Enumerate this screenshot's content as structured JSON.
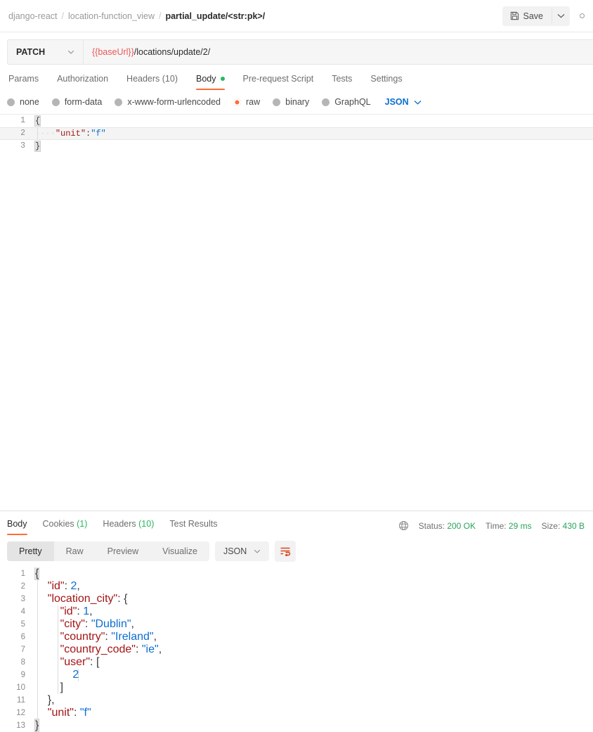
{
  "header": {
    "breadcrumb": [
      "django-react",
      "location-function_view",
      "partial_update/<str:pk>/"
    ],
    "separator": "/",
    "save_label": "Save",
    "save_icon": "floppy-disk-icon",
    "caret_icon": "chevron-down-icon",
    "more_icon": "more-options-icon"
  },
  "request": {
    "method": "PATCH",
    "url_variable": "{{baseUrl}}",
    "url_path": "/locations/update/2/",
    "tabs": [
      {
        "label": "Params",
        "active": false,
        "dot": false
      },
      {
        "label": "Authorization",
        "active": false,
        "dot": false
      },
      {
        "label": "Headers (10)",
        "active": false,
        "dot": false
      },
      {
        "label": "Body",
        "active": true,
        "dot": true
      },
      {
        "label": "Pre-request Script",
        "active": false,
        "dot": false
      },
      {
        "label": "Tests",
        "active": false,
        "dot": false
      },
      {
        "label": "Settings",
        "active": false,
        "dot": false
      }
    ],
    "body_types": [
      {
        "label": "none",
        "selected": false
      },
      {
        "label": "form-data",
        "selected": false
      },
      {
        "label": "x-www-form-urlencoded",
        "selected": false
      },
      {
        "label": "raw",
        "selected": true
      },
      {
        "label": "binary",
        "selected": false
      },
      {
        "label": "GraphQL",
        "selected": false
      }
    ],
    "format": "JSON",
    "body_lines": [
      {
        "num": "1",
        "active": false,
        "tokens": [
          {
            "t": "{",
            "c": "brace-hl p"
          }
        ]
      },
      {
        "num": "2",
        "active": true,
        "tokens": [
          {
            "t": "····",
            "c": "ws"
          },
          {
            "t": "\"unit\"",
            "c": "k"
          },
          {
            "t": ":",
            "c": "p"
          },
          {
            "t": "\"f\"",
            "c": "s"
          }
        ]
      },
      {
        "num": "3",
        "active": false,
        "tokens": [
          {
            "t": "}",
            "c": "brace-hl p"
          }
        ]
      }
    ]
  },
  "response": {
    "tabs": [
      {
        "label": "Body",
        "count": "",
        "active": true
      },
      {
        "label": "Cookies",
        "count": "(1)",
        "active": false
      },
      {
        "label": "Headers",
        "count": "(10)",
        "active": false
      },
      {
        "label": "Test Results",
        "count": "",
        "active": false
      }
    ],
    "globe_icon": "globe-icon",
    "status_label": "Status:",
    "status_value": "200 OK",
    "time_label": "Time:",
    "time_value": "29 ms",
    "size_label": "Size:",
    "size_value": "430 B",
    "view_modes": [
      {
        "label": "Pretty",
        "active": true
      },
      {
        "label": "Raw",
        "active": false
      },
      {
        "label": "Preview",
        "active": false
      },
      {
        "label": "Visualize",
        "active": false
      }
    ],
    "format": "JSON",
    "wrap_icon": "wrap-text-icon",
    "body_lines": [
      {
        "num": "1",
        "tokens": [
          {
            "t": "{",
            "c": "brace-hl p"
          }
        ]
      },
      {
        "num": "2",
        "tokens": [
          {
            "t": "    ",
            "c": "p"
          },
          {
            "t": "\"id\"",
            "c": "k"
          },
          {
            "t": ": ",
            "c": "p"
          },
          {
            "t": "2",
            "c": "n"
          },
          {
            "t": ",",
            "c": "p"
          }
        ]
      },
      {
        "num": "3",
        "tokens": [
          {
            "t": "    ",
            "c": "p"
          },
          {
            "t": "\"location_city\"",
            "c": "k"
          },
          {
            "t": ": ",
            "c": "p"
          },
          {
            "t": "{",
            "c": "p"
          }
        ]
      },
      {
        "num": "4",
        "tokens": [
          {
            "t": "        ",
            "c": "p"
          },
          {
            "t": "\"id\"",
            "c": "k"
          },
          {
            "t": ": ",
            "c": "p"
          },
          {
            "t": "1",
            "c": "n"
          },
          {
            "t": ",",
            "c": "p"
          }
        ]
      },
      {
        "num": "5",
        "tokens": [
          {
            "t": "        ",
            "c": "p"
          },
          {
            "t": "\"city\"",
            "c": "k"
          },
          {
            "t": ": ",
            "c": "p"
          },
          {
            "t": "\"Dublin\"",
            "c": "s"
          },
          {
            "t": ",",
            "c": "p"
          }
        ]
      },
      {
        "num": "6",
        "tokens": [
          {
            "t": "        ",
            "c": "p"
          },
          {
            "t": "\"country\"",
            "c": "k"
          },
          {
            "t": ": ",
            "c": "p"
          },
          {
            "t": "\"Ireland\"",
            "c": "s"
          },
          {
            "t": ",",
            "c": "p"
          }
        ]
      },
      {
        "num": "7",
        "tokens": [
          {
            "t": "        ",
            "c": "p"
          },
          {
            "t": "\"country_code\"",
            "c": "k"
          },
          {
            "t": ": ",
            "c": "p"
          },
          {
            "t": "\"ie\"",
            "c": "s"
          },
          {
            "t": ",",
            "c": "p"
          }
        ]
      },
      {
        "num": "8",
        "tokens": [
          {
            "t": "        ",
            "c": "p"
          },
          {
            "t": "\"user\"",
            "c": "k"
          },
          {
            "t": ": ",
            "c": "p"
          },
          {
            "t": "[",
            "c": "p"
          }
        ]
      },
      {
        "num": "9",
        "tokens": [
          {
            "t": "            ",
            "c": "p"
          },
          {
            "t": "2",
            "c": "n"
          }
        ]
      },
      {
        "num": "10",
        "tokens": [
          {
            "t": "        ",
            "c": "p"
          },
          {
            "t": "]",
            "c": "p"
          }
        ]
      },
      {
        "num": "11",
        "tokens": [
          {
            "t": "    ",
            "c": "p"
          },
          {
            "t": "}",
            "c": "p"
          },
          {
            "t": ",",
            "c": "p"
          }
        ]
      },
      {
        "num": "12",
        "tokens": [
          {
            "t": "    ",
            "c": "p"
          },
          {
            "t": "\"unit\"",
            "c": "k"
          },
          {
            "t": ": ",
            "c": "p"
          },
          {
            "t": "\"f\"",
            "c": "s"
          }
        ]
      },
      {
        "num": "13",
        "tokens": [
          {
            "t": "}",
            "c": "brace-hl p"
          }
        ]
      }
    ]
  },
  "colors": {
    "accent": "#ff6c37",
    "success": "#29b660",
    "link": "#0b6ed0",
    "variable": "#eb5757",
    "key": "#a31515"
  }
}
